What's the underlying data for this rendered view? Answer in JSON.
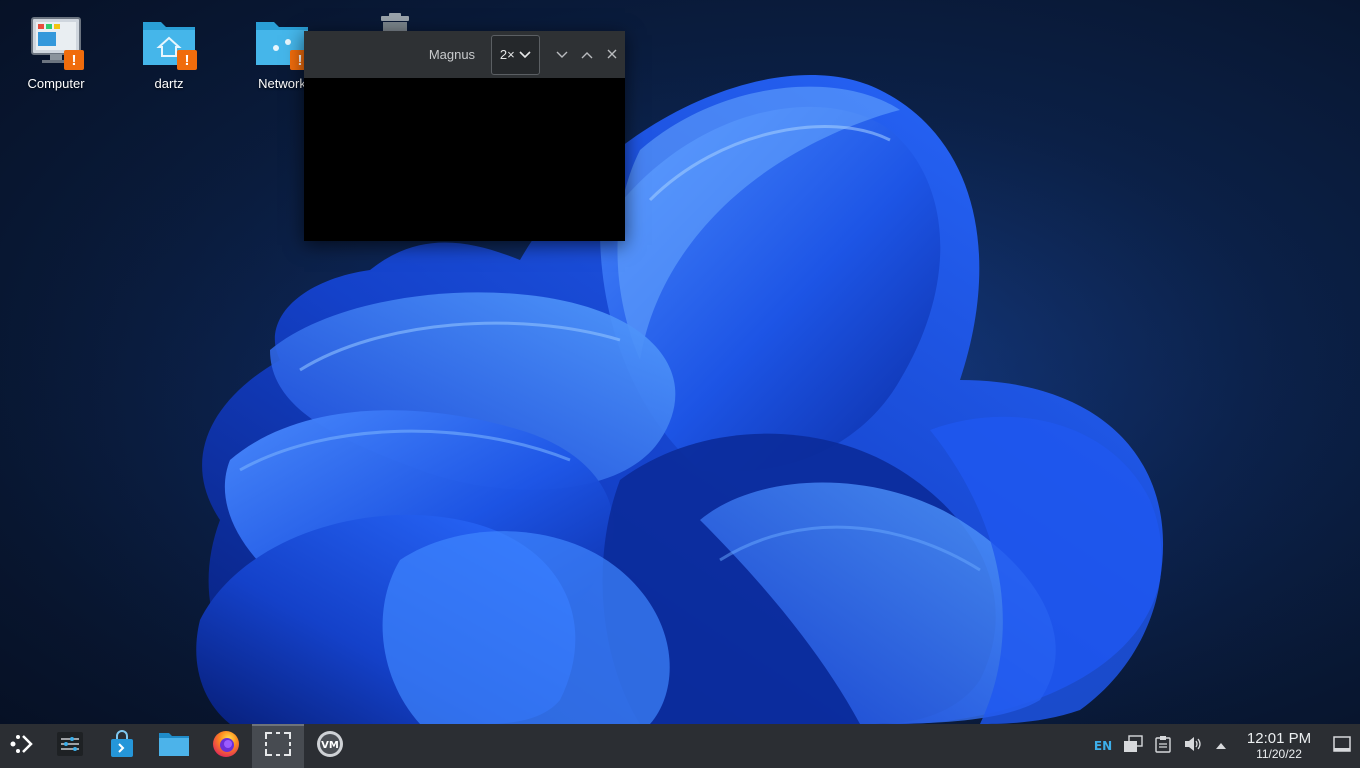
{
  "desktop": {
    "icons": [
      {
        "label": "Computer",
        "icon": "computer-icon"
      },
      {
        "label": "dartz",
        "icon": "home-folder-icon"
      },
      {
        "label": "Network",
        "icon": "network-folder-icon"
      },
      {
        "label": "",
        "icon": "trash-icon"
      }
    ]
  },
  "magnus": {
    "title": "Magnus",
    "zoom_value": "2×",
    "buttons": [
      "minimize",
      "maximize",
      "close"
    ]
  },
  "taskbar": {
    "apps": [
      {
        "name": "application-launcher",
        "icon": "kde-launcher-icon"
      },
      {
        "name": "system-settings",
        "icon": "settings-sliders-icon"
      },
      {
        "name": "discover",
        "icon": "store-bag-icon"
      },
      {
        "name": "dolphin",
        "icon": "folder-icon"
      },
      {
        "name": "firefox",
        "icon": "firefox-icon"
      },
      {
        "name": "spectacle",
        "icon": "screenshot-icon",
        "active": true
      },
      {
        "name": "vmware",
        "icon": "vm-icon"
      }
    ],
    "tray": {
      "language": "EN",
      "clock_time": "12:01 PM",
      "clock_date": "11/20/22"
    }
  },
  "colors": {
    "accent": "#3daee9",
    "badge": "#f06c0c",
    "taskbar": "#2b2e33"
  }
}
